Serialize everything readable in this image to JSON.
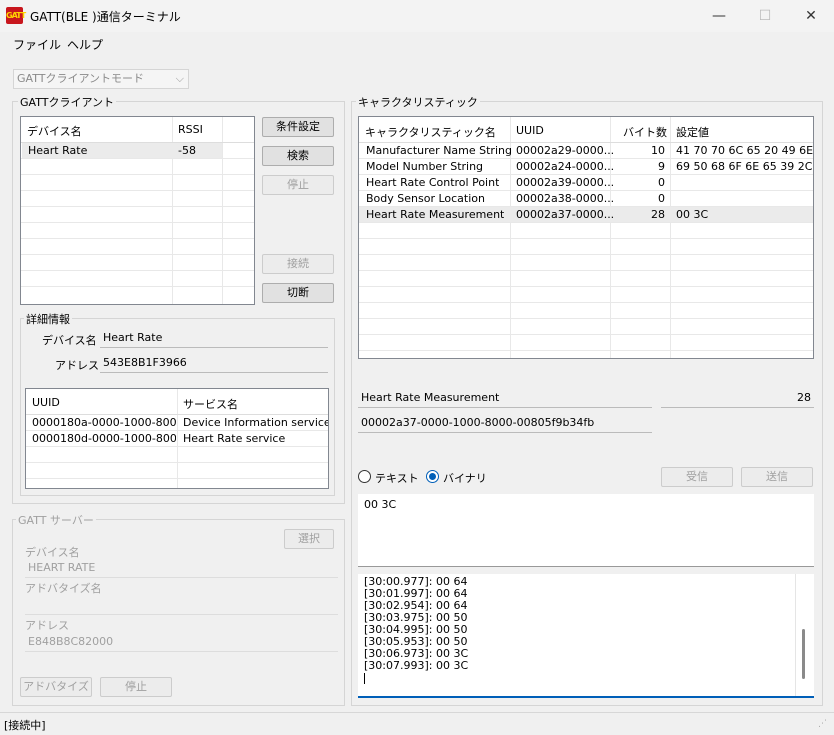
{
  "window": {
    "title": "GATT(BLE )通信ターミナル",
    "icon_text": "GATT",
    "min_glyph": "—",
    "max_glyph": "☐",
    "close_glyph": "✕"
  },
  "menu": {
    "file": "ファイル",
    "help": "ヘルプ"
  },
  "mode_combo": "GATTクライアントモード",
  "client": {
    "group_label": "GATTクライアント",
    "columns": [
      "デバイス名",
      "RSSI"
    ],
    "devices": [
      {
        "name": "Heart Rate",
        "rssi": "-58"
      }
    ],
    "buttons": {
      "settings": "条件設定",
      "search": "検索",
      "stop": "停止",
      "connect": "接続",
      "disconnect": "切断"
    }
  },
  "details": {
    "group_label": "詳細情報",
    "device_name_label": "デバイス名",
    "device_name_value": "Heart Rate",
    "address_label": "アドレス",
    "address_value": "543E8B1F3966",
    "columns": [
      "UUID",
      "サービス名"
    ],
    "services": [
      {
        "uuid": "0000180a-0000-1000-800...",
        "name": "Device Information service"
      },
      {
        "uuid": "0000180d-0000-1000-800...",
        "name": "Heart Rate service"
      }
    ]
  },
  "server": {
    "group_label": "GATT サーバー",
    "select_button": "選択",
    "device_name_label": "デバイス名",
    "device_name_value": "HEART RATE",
    "advertise_name_label": "アドバタイズ名",
    "advertise_name_value": "",
    "address_label": "アドレス",
    "address_value": "E848B8C82000",
    "advertise_button": "アドバタイズ",
    "stop_button": "停止"
  },
  "characteristic": {
    "group_label": "キャラクタリスティック",
    "columns": [
      "キャラクタリスティック名",
      "UUID",
      "バイト数",
      "設定値"
    ],
    "rows": [
      {
        "name": "Manufacturer Name String",
        "uuid": "00002a29-0000...",
        "bytes": "10",
        "value": "41 70 70 6C 65 20 49 6E 6"
      },
      {
        "name": "Model Number String",
        "uuid": "00002a24-0000...",
        "bytes": "9",
        "value": "69 50 68 6F 6E 65 39 2C 3"
      },
      {
        "name": "Heart Rate Control Point",
        "uuid": "00002a39-0000...",
        "bytes": "0",
        "value": ""
      },
      {
        "name": "Body Sensor Location",
        "uuid": "00002a38-0000...",
        "bytes": "0",
        "value": ""
      },
      {
        "name": "Heart Rate Measurement",
        "uuid": "00002a37-0000...",
        "bytes": "28",
        "value": "00 3C"
      }
    ],
    "selected_name": "Heart Rate Measurement",
    "selected_bytes": "28",
    "selected_uuid": "00002a37-0000-1000-8000-00805f9b34fb"
  },
  "io": {
    "text_radio": "テキスト",
    "binary_radio": "バイナリ",
    "receive_button": "受信",
    "send_button": "送信",
    "send_data": "00 3C",
    "log": [
      "[30:00.977]: 00 64",
      "[30:01.997]: 00 64",
      "[30:02.954]: 00 64",
      "[30:03.975]: 00 50",
      "[30:04.995]: 00 50",
      "[30:05.953]: 00 50",
      "[30:06.973]: 00 3C",
      "[30:07.993]: 00 3C"
    ]
  },
  "status": "[接続中]"
}
